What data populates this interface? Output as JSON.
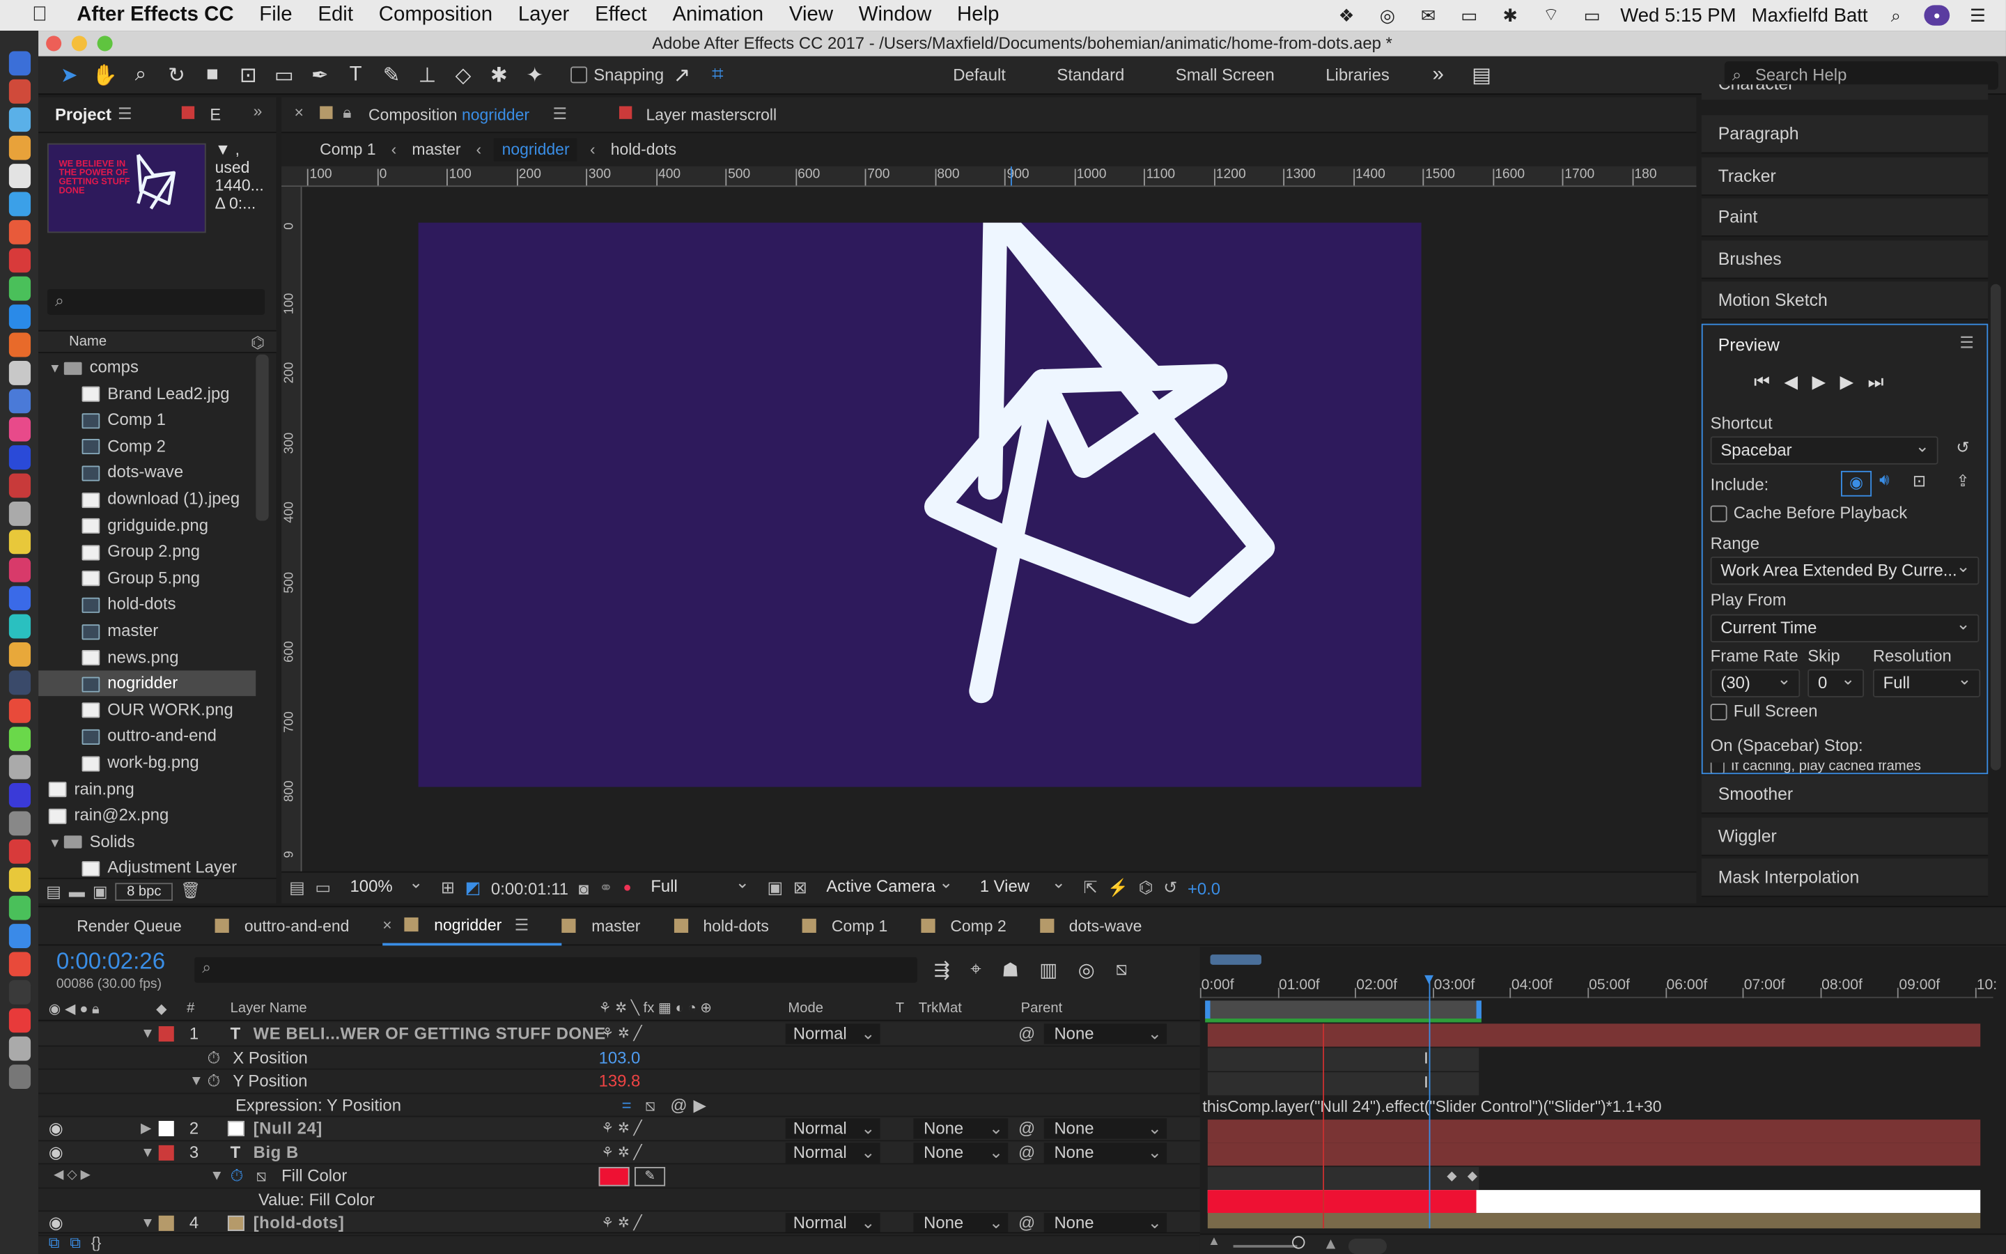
{
  "menubar": {
    "app": "After Effects CC",
    "items": [
      "File",
      "Edit",
      "Composition",
      "Layer",
      "Effect",
      "Animation",
      "View",
      "Window",
      "Help"
    ],
    "clock": "Wed 5:15 PM",
    "user": "Maxfielfd Batt"
  },
  "window": {
    "title": "Adobe After Effects CC 2017 - /Users/Maxfield/Documents/bohemian/animatic/home-from-dots.aep *"
  },
  "toolbar": {
    "snapping": "Snapping",
    "workspaces": [
      "Default",
      "Standard",
      "Small Screen",
      "Libraries"
    ],
    "search_placeholder": "Search Help"
  },
  "project": {
    "tab": "Project",
    "tab2": "E",
    "info_line1": "▼ , used",
    "info_line2": "1440...",
    "info_line3": "Δ 0:...",
    "thumb_text": "WE BELIEVE IN THE POWER OF GETTING STUFF DONE",
    "col_name": "Name",
    "bpc": "8 bpc",
    "items": [
      {
        "label": "comps",
        "kind": "folder",
        "indent": 0,
        "open": true
      },
      {
        "label": "Brand Lead2.jpg",
        "kind": "img",
        "indent": 1
      },
      {
        "label": "Comp 1",
        "kind": "comp",
        "indent": 1
      },
      {
        "label": "Comp 2",
        "kind": "comp",
        "indent": 1
      },
      {
        "label": "dots-wave",
        "kind": "comp",
        "indent": 1
      },
      {
        "label": "download (1).jpeg",
        "kind": "img",
        "indent": 1
      },
      {
        "label": "gridguide.png",
        "kind": "img",
        "indent": 1
      },
      {
        "label": "Group 2.png",
        "kind": "img",
        "indent": 1
      },
      {
        "label": "Group 5.png",
        "kind": "img",
        "indent": 1
      },
      {
        "label": "hold-dots",
        "kind": "comp",
        "indent": 1
      },
      {
        "label": "master",
        "kind": "comp",
        "indent": 1
      },
      {
        "label": "news.png",
        "kind": "img",
        "indent": 1
      },
      {
        "label": "nogridder",
        "kind": "comp",
        "indent": 1,
        "selected": true
      },
      {
        "label": "OUR WORK.png",
        "kind": "img",
        "indent": 1
      },
      {
        "label": "outtro-and-end",
        "kind": "comp",
        "indent": 1
      },
      {
        "label": "work-bg.png",
        "kind": "img",
        "indent": 1
      },
      {
        "label": "rain.png",
        "kind": "img",
        "indent": 0
      },
      {
        "label": "rain@2x.png",
        "kind": "img",
        "indent": 0
      },
      {
        "label": "Solids",
        "kind": "folder",
        "indent": 0,
        "open": true
      },
      {
        "label": "Adjustment Layer",
        "kind": "solid",
        "indent": 1
      }
    ]
  },
  "composition": {
    "tab_prefix": "Composition",
    "tab_name": "nogridder",
    "layer_tab": "Layer masterscroll",
    "breadcrumbs": [
      "Comp 1",
      "master",
      "nogridder",
      "hold-dots"
    ],
    "ruler": [
      "100",
      "0",
      "100",
      "200",
      "300",
      "400",
      "500",
      "600",
      "700",
      "800",
      "900",
      "1000",
      "1100",
      "1200",
      "1300",
      "1400",
      "1500",
      "1600",
      "1700",
      "180"
    ],
    "vruler": [
      "0",
      "100",
      "200",
      "300",
      "400",
      "500",
      "600",
      "700",
      "800",
      "9"
    ],
    "footer": {
      "zoom": "100%",
      "timecode": "0:00:01:11",
      "resolution": "Full",
      "camera": "Active Camera",
      "views": "1 View",
      "exposure": "+0.0"
    },
    "bg_color": "#2e1a5c",
    "stroke_color": "#eef6ff"
  },
  "right_panels": {
    "top_cut": "Character",
    "items": [
      "Paragraph",
      "Tracker",
      "Paint",
      "Brushes",
      "Motion Sketch"
    ],
    "preview": {
      "title": "Preview",
      "shortcut_label": "Shortcut",
      "shortcut": "Spacebar",
      "include_label": "Include:",
      "cache": "Cache Before Playback",
      "range_label": "Range",
      "range": "Work Area Extended By Curre...",
      "playfrom_label": "Play From",
      "playfrom": "Current Time",
      "fr_label": "Frame Rate",
      "skip_label": "Skip",
      "res_label": "Resolution",
      "fr": "(30)",
      "skip": "0",
      "res": "Full",
      "fullscreen": "Full Screen",
      "stop_label": "On (Spacebar) Stop:",
      "stop_cut": "If caching, play cached frames"
    },
    "bottom_items": [
      "Smoother",
      "Wiggler",
      "Mask Interpolation"
    ]
  },
  "timeline": {
    "tabs": [
      {
        "label": "Render Queue",
        "color": ""
      },
      {
        "label": "outtro-and-end",
        "color": "#b59a6a"
      },
      {
        "label": "nogridder",
        "color": "#b59a6a",
        "active": true
      },
      {
        "label": "master",
        "color": "#b59a6a"
      },
      {
        "label": "hold-dots",
        "color": "#b59a6a"
      },
      {
        "label": "Comp 1",
        "color": "#b59a6a"
      },
      {
        "label": "Comp 2",
        "color": "#b59a6a"
      },
      {
        "label": "dots-wave",
        "color": "#b59a6a"
      }
    ],
    "timecode": "0:00:02:26",
    "fps": "00086 (30.00 fps)",
    "headers": {
      "num": "#",
      "name": "Layer Name",
      "mode": "Mode",
      "t": "T",
      "trkmat": "TrkMat",
      "parent": "Parent"
    },
    "ruler": [
      "0:00f",
      "01:00f",
      "02:00f",
      "03:00f",
      "04:00f",
      "05:00f",
      "06:00f",
      "07:00f",
      "08:00f",
      "09:00f",
      "10:"
    ],
    "expression": "thisComp.layer(\"Null 24\").effect(\"Slider Control\")(\"Slider\")*1.1+30",
    "rows": [
      {
        "type": "layer",
        "num": "1",
        "tchar": "T",
        "name": "WE BELI...WER OF GETTING STUFF DONE",
        "label_color": "#cc3a3a",
        "mode": "Normal",
        "trkmat": "",
        "parent": "None",
        "twirl": "▼"
      },
      {
        "type": "prop",
        "name": "X Position",
        "value": "103.0",
        "vcolor": "#4f9cf0"
      },
      {
        "type": "prop",
        "name": "Y Position",
        "value": "139.8",
        "vcolor": "#ee4444",
        "twirl": "▼"
      },
      {
        "type": "expr",
        "name": "Expression: Y Position"
      },
      {
        "type": "layer",
        "num": "2",
        "tchar": "",
        "name": "[Null 24]",
        "label_color": "#ffffff",
        "mode": "Normal",
        "trkmat": "None",
        "parent": "None",
        "twirl": "▶"
      },
      {
        "type": "layer",
        "num": "3",
        "tchar": "T",
        "name": "Big B",
        "label_color": "#cc3a3a",
        "mode": "Normal",
        "trkmat": "None",
        "parent": "None",
        "twirl": "▼"
      },
      {
        "type": "fill",
        "name": "Fill Color",
        "color": "#ee1133"
      },
      {
        "type": "value",
        "name": "Value: Fill Color"
      },
      {
        "type": "layer",
        "num": "4",
        "tchar": "",
        "name": "[hold-dots]",
        "label_color": "#b59a6a",
        "mode": "Normal",
        "trkmat": "None",
        "parent": "None",
        "twirl": "▼"
      }
    ]
  }
}
